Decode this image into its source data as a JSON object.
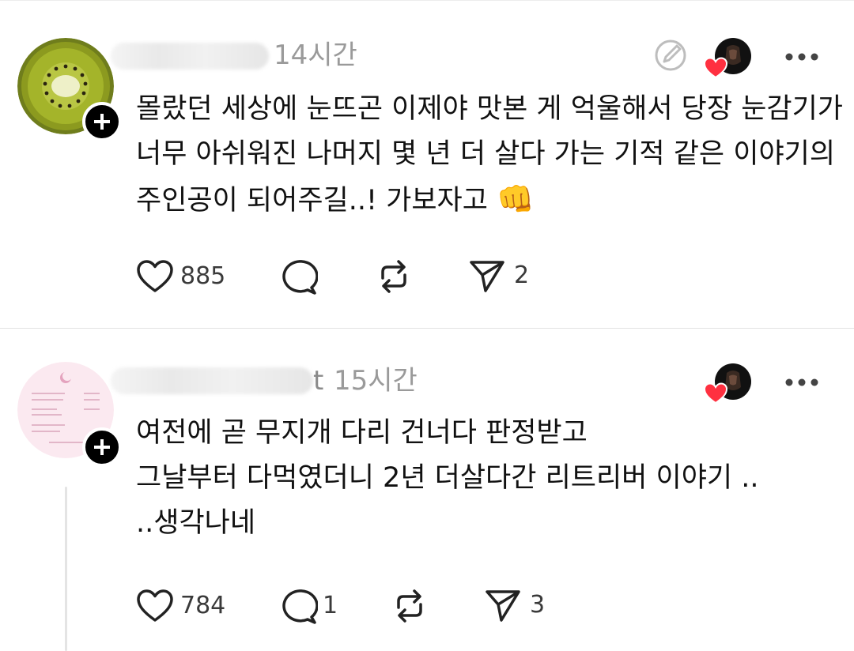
{
  "posts": [
    {
      "username_suffix": "",
      "time": "14시간",
      "body_lines": [
        "몰랐던 세상에 눈뜨곤 이제야 맛본 게 억울해서 당장 눈감기가",
        "너무 아쉬워진 나머지 몇 년 더 살다 가는 기적 같은 이야기의",
        "주인공이 되어주길..! 가보자고 "
      ],
      "emoji": "👊",
      "likes": "885",
      "replies": "",
      "reposts": "",
      "shares": "2"
    },
    {
      "username_suffix": "t",
      "time": "15시간",
      "body_lines": [
        "여전에 곧 무지개 다리 건너다 판정받고",
        "그날부터 다먹였더니 2년 더살다간 리트리버 이야기 ..",
        "..생각나네"
      ],
      "emoji": "",
      "likes": "784",
      "replies": "1",
      "reposts": "",
      "shares": "3"
    }
  ],
  "icons": {
    "like": "heart-outline-icon",
    "reply": "speech-bubble-icon",
    "repost": "repost-arrows-icon",
    "share": "paper-plane-icon",
    "more": "ellipsis-icon",
    "edit": "edit-pencil-circle-icon",
    "liked_badge": "red-heart-icon"
  },
  "colors": {
    "heart_red": "#ff3040",
    "muted_text": "#9a9a9a",
    "body_text": "#111111",
    "follow_badge": "#000000"
  }
}
